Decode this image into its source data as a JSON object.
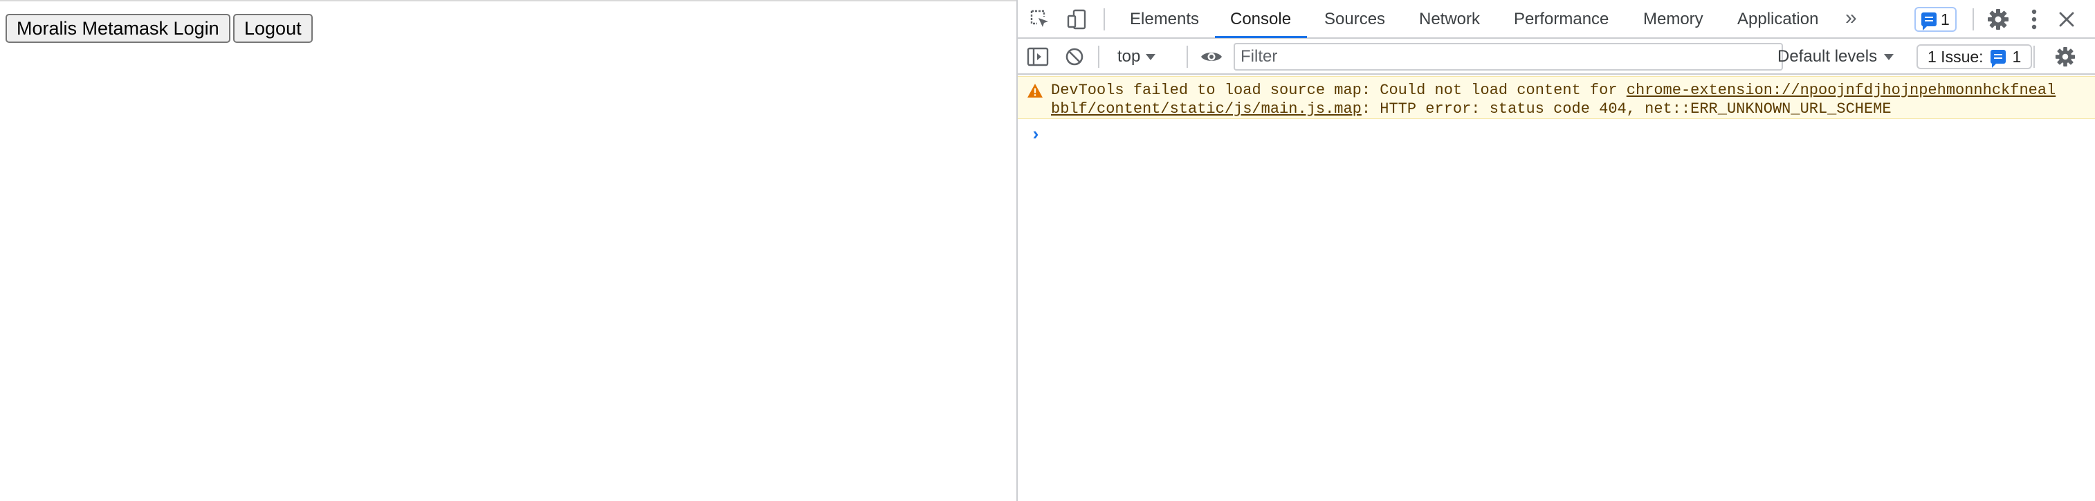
{
  "page": {
    "login_button": "Moralis Metamask Login",
    "logout_button": "Logout"
  },
  "devtools": {
    "tabs": [
      "Elements",
      "Console",
      "Sources",
      "Network",
      "Performance",
      "Memory",
      "Application"
    ],
    "active_tab": "Console",
    "more_tabs_glyph": "»",
    "message_badge_count": "1",
    "toolbar": {
      "context": "top",
      "filter_placeholder": "Filter",
      "levels": "Default levels",
      "issues_label": "1 Issue:",
      "issues_count": "1"
    },
    "console": {
      "warning": {
        "prefix": "DevTools failed to load source map: Could not load content for ",
        "link_line1": "chrome-extension://npoojnfdjhojnpehmonnhckfneal",
        "link_line2": "bblf/content/static/js/main.js.map",
        "suffix": ": HTTP error: status code 404, net::ERR_UNKNOWN_URL_SCHEME"
      },
      "prompt_glyph": "›"
    },
    "icons": {
      "inspect": "inspect-element-icon",
      "device": "device-toolbar-icon",
      "settings": "gear-icon",
      "more": "kebab-menu-icon",
      "close": "close-icon",
      "sidebar": "sidebar-toggle-icon",
      "clear": "clear-console-icon",
      "eye": "eye-icon",
      "warning": "warning-triangle-icon"
    },
    "colors": {
      "accent": "#1a73e8",
      "warning_background": "#fffbe5",
      "warning_text": "#5c3c00",
      "warning_icon": "#e37400"
    }
  }
}
